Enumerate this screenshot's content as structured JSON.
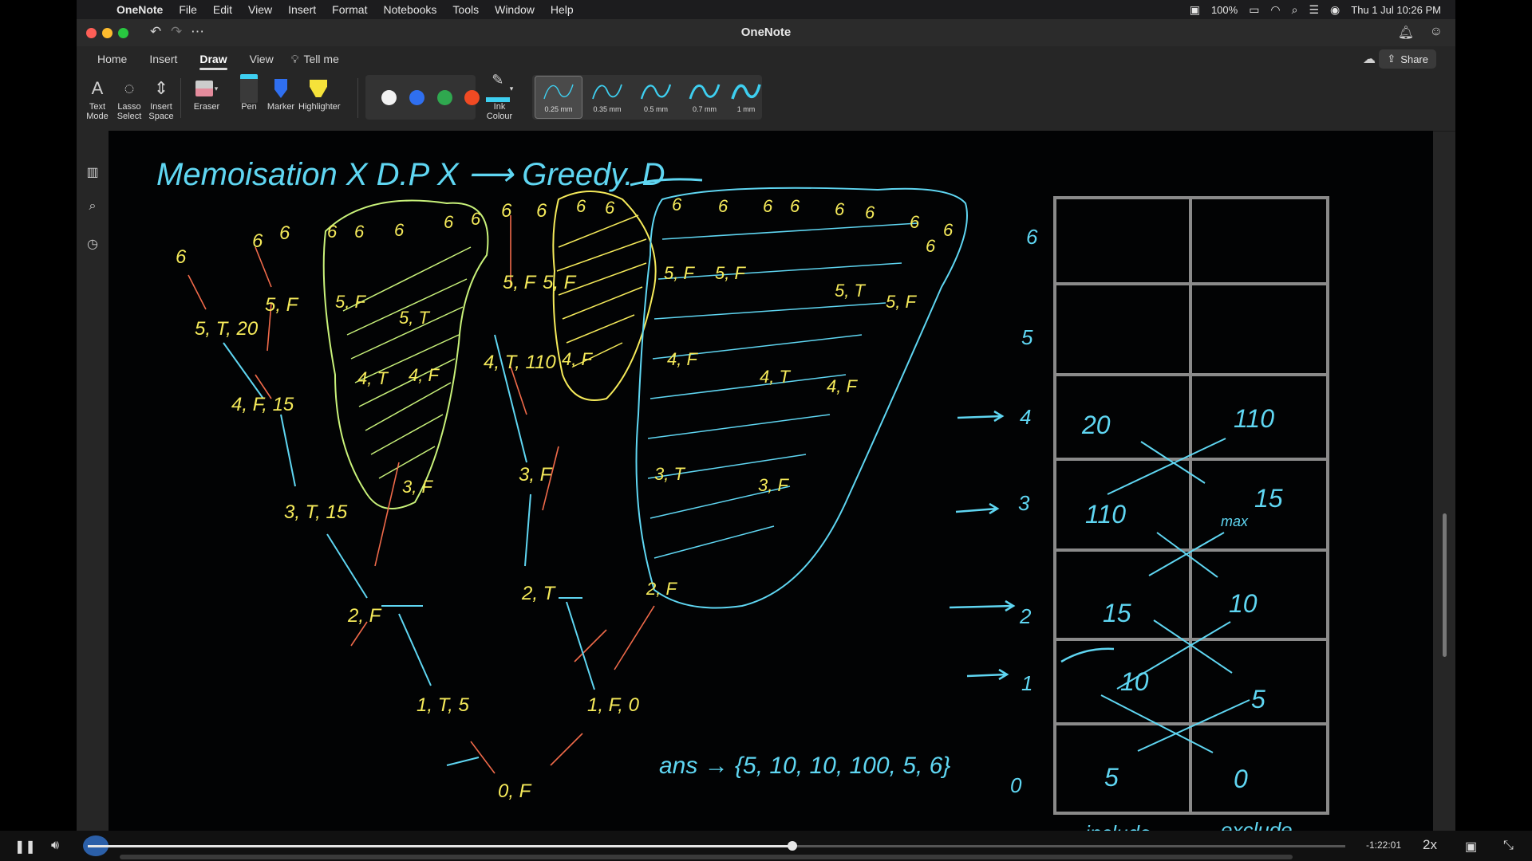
{
  "menubar": {
    "app": "OneNote",
    "items": [
      "File",
      "Edit",
      "View",
      "Insert",
      "Format",
      "Notebooks",
      "Tools",
      "Window",
      "Help"
    ],
    "battery": "100%",
    "datetime": "Thu 1 Jul  10:26 PM"
  },
  "window": {
    "title": "OneNote"
  },
  "tabs": [
    "Home",
    "Insert",
    "Draw",
    "View"
  ],
  "tell_me": "Tell me",
  "share_label": "Share",
  "ribbon": {
    "text_mode": "Text Mode",
    "lasso_select": "Lasso Select",
    "insert_space": "Insert Space",
    "eraser": "Eraser",
    "pen": "Pen",
    "marker": "Marker",
    "highlighter": "Highlighter",
    "ink_colour": "Ink Colour",
    "swatches": [
      "#f2f2f2",
      "#2f6ff0",
      "#2fa84f",
      "#f04a23"
    ],
    "pens": [
      "0.25 mm",
      "0.35 mm",
      "0.5 mm",
      "0.7 mm",
      "1 mm"
    ]
  },
  "canvas": {
    "heading": "Memoisation  X     D.P X   ⟶     Greedy.      D",
    "answer": "ans → {5, 10, 10, 100, 5, 6}",
    "include_label": "include",
    "exclude_label": "exclude",
    "left_tree": [
      "6",
      "6",
      "6",
      "5, T, 20",
      "5, F",
      "4, F, 15",
      "3, T, 15",
      "2, F",
      "1, T, 5",
      "0, F"
    ],
    "middle_tree": [
      "6",
      "6",
      "5, F",
      "5, F",
      "4, T, 110",
      "3, F",
      "2, T",
      "1, F, 0"
    ],
    "right_group": [
      "6",
      "6",
      "6",
      "6",
      "6",
      "6",
      "6",
      "6",
      "6",
      "5, F",
      "5, F",
      "5, T",
      "5, F",
      "4, F",
      "4, T",
      "4, F",
      "3, T",
      "3, F",
      "2, F"
    ],
    "green_group": [
      "6",
      "6",
      "6",
      "6",
      "6",
      "5, T",
      "5, F",
      "4, T",
      "4, F",
      "3, F"
    ],
    "yellow_group": [
      "6",
      "6",
      "4, F"
    ],
    "row_numbers": [
      "6",
      "5",
      "4",
      "3",
      "2",
      "1",
      "0"
    ],
    "table_values": {
      "r4_include": "20",
      "r4_exclude": "110",
      "r3_include": "110",
      "r3_exclude": "15",
      "r3_note": "max",
      "r2_include": "15",
      "r2_exclude": "10",
      "r1_include": "10",
      "r1_exclude": "5",
      "r0_include": "5",
      "r0_exclude": "0"
    }
  },
  "player": {
    "time_remaining": "-1:22:01",
    "speed": "2x",
    "progress": 0.56
  }
}
